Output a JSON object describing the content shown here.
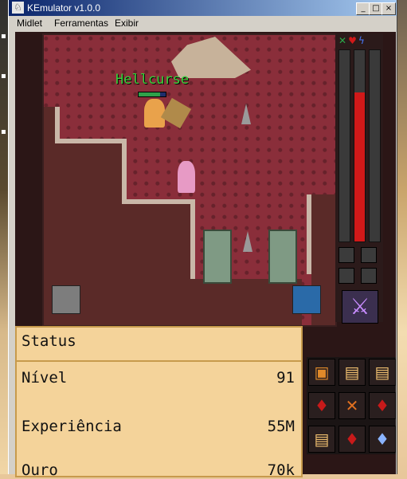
{
  "window": {
    "title": "KEmulator v1.0.0",
    "buttons": {
      "minimize": "_",
      "maximize": "□",
      "close": "×"
    }
  },
  "menu": [
    "Midlet",
    "Ferramentas",
    "Exibir"
  ],
  "game": {
    "player_name": "Hellcurse",
    "hud": {
      "icons": [
        "attack-icon",
        "heart-icon",
        "lightning-icon"
      ],
      "bars": [
        {
          "name": "green",
          "color": "#2aa84a",
          "level": 0
        },
        {
          "name": "red",
          "color": "#d11919",
          "level": 0.78
        },
        {
          "name": "blue",
          "color": "#2266dd",
          "level": 0
        }
      ]
    }
  },
  "status": {
    "title": "Status",
    "rows": [
      {
        "label": "Nível",
        "value": "91"
      },
      {
        "label": "Experiência",
        "value": "55M"
      },
      {
        "label": "Ouro",
        "value": "70k"
      }
    ]
  },
  "inventory": {
    "items": [
      "spellbook-icon",
      "scroll-icon",
      "scroll-icon",
      "potion-red-icon",
      "scroll-x-icon",
      "potion-red-icon",
      "scroll-icon",
      "potion-red-icon",
      "potion-blue-icon"
    ]
  }
}
